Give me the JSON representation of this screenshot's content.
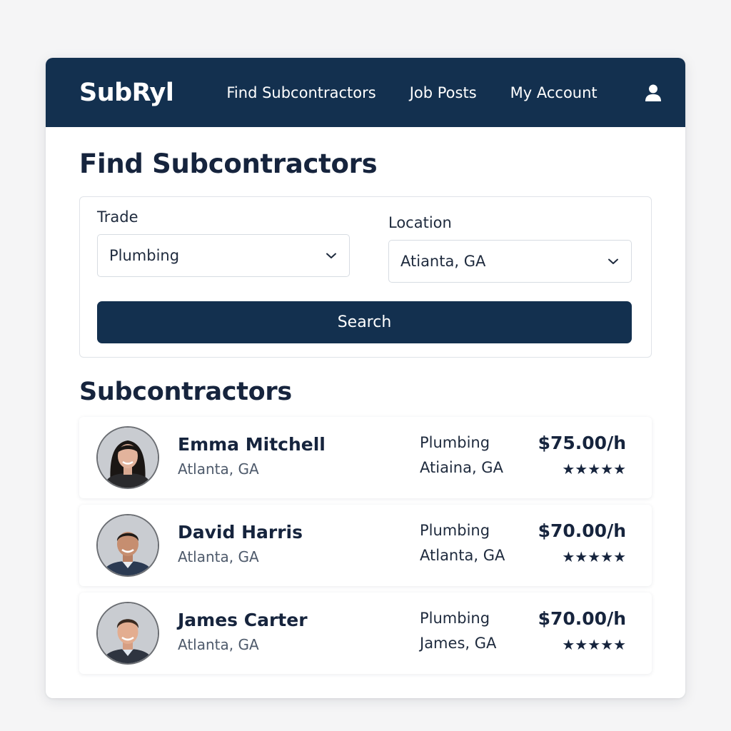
{
  "app": {
    "brand": "SubRyl",
    "nav": [
      {
        "label": "Find Subcontractors"
      },
      {
        "label": "Job Posts"
      },
      {
        "label": "My Account"
      }
    ],
    "user_icon": "user-icon",
    "accent_color": "#13304f"
  },
  "page": {
    "title": "Find Subcontractors"
  },
  "search": {
    "trade_label": "Trade",
    "trade_value": "Plumbing",
    "location_label": "Location",
    "location_value": "Atianta, GA",
    "button_label": "Search"
  },
  "results": {
    "title": "Subcontractors",
    "items": [
      {
        "name": "Emma Mitchell",
        "city": "Atlanta, GA",
        "trade": "Plumbing",
        "trade_city": "Atiaina, GA",
        "rate": "$75.00/h",
        "stars": "★★★★★",
        "rating": 5,
        "avatar": "avatar-photo-woman"
      },
      {
        "name": "David Harris",
        "city": "Atlanta, GA",
        "trade": "Plumbing",
        "trade_city": "Atlanta, GA",
        "rate": "$70.00/h",
        "stars": "★★★★★",
        "rating": 5,
        "avatar": "avatar-photo-man"
      },
      {
        "name": "James Carter",
        "city": "Atlanta, GA",
        "trade": "Plumbing",
        "trade_city": "James, GA",
        "rate": "$70.00/h",
        "stars": "★★★★★",
        "rating": 5,
        "avatar": "avatar-photo-man"
      }
    ]
  }
}
